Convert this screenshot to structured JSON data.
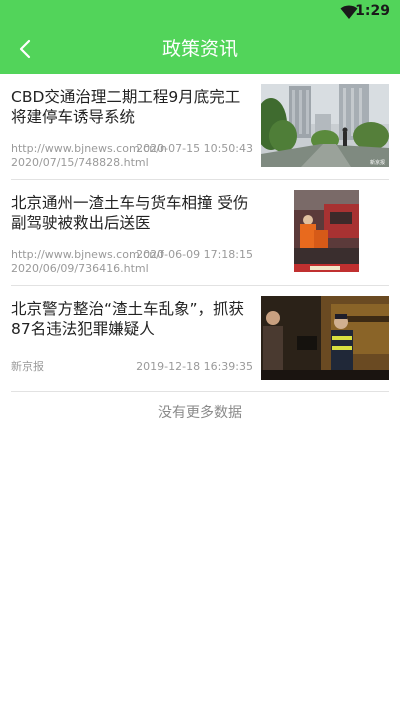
{
  "status_bar": {
    "time": "1:29",
    "wifi_icon": "wifi-icon"
  },
  "app_bar": {
    "title": "政策资讯",
    "back_icon": "back-chevron-icon"
  },
  "news": [
    {
      "title": "CBD交通治理二期工程9月底完工将建停车诱导系统",
      "source_line1": "http://www.bjnews.com.cn/n",
      "source_line2": "2020/07/15/748828.html",
      "time": "2020-07-15 10:50:43",
      "thumb_caption": "新京报"
    },
    {
      "title": "北京通州一渣土车与货车相撞 受伤副驾驶被救出后送医",
      "source_line1": "http://www.bjnews.com.cn/f",
      "source_line2": "2020/06/09/736416.html",
      "time": "2020-06-09 17:18:15",
      "thumb_caption": ""
    },
    {
      "title": "北京警方整治“渣土车乱象”，抓获87名违法犯罪嫌疑人",
      "source_line1": "新京报",
      "source_line2": "",
      "time": "2019-12-18 16:39:35",
      "thumb_caption": ""
    }
  ],
  "footer": {
    "no_more": "没有更多数据"
  },
  "colors": {
    "primary": "#52d45a",
    "title_text": "#222222",
    "meta_text": "#9a9a9a",
    "divider": "#e2e2e2"
  }
}
